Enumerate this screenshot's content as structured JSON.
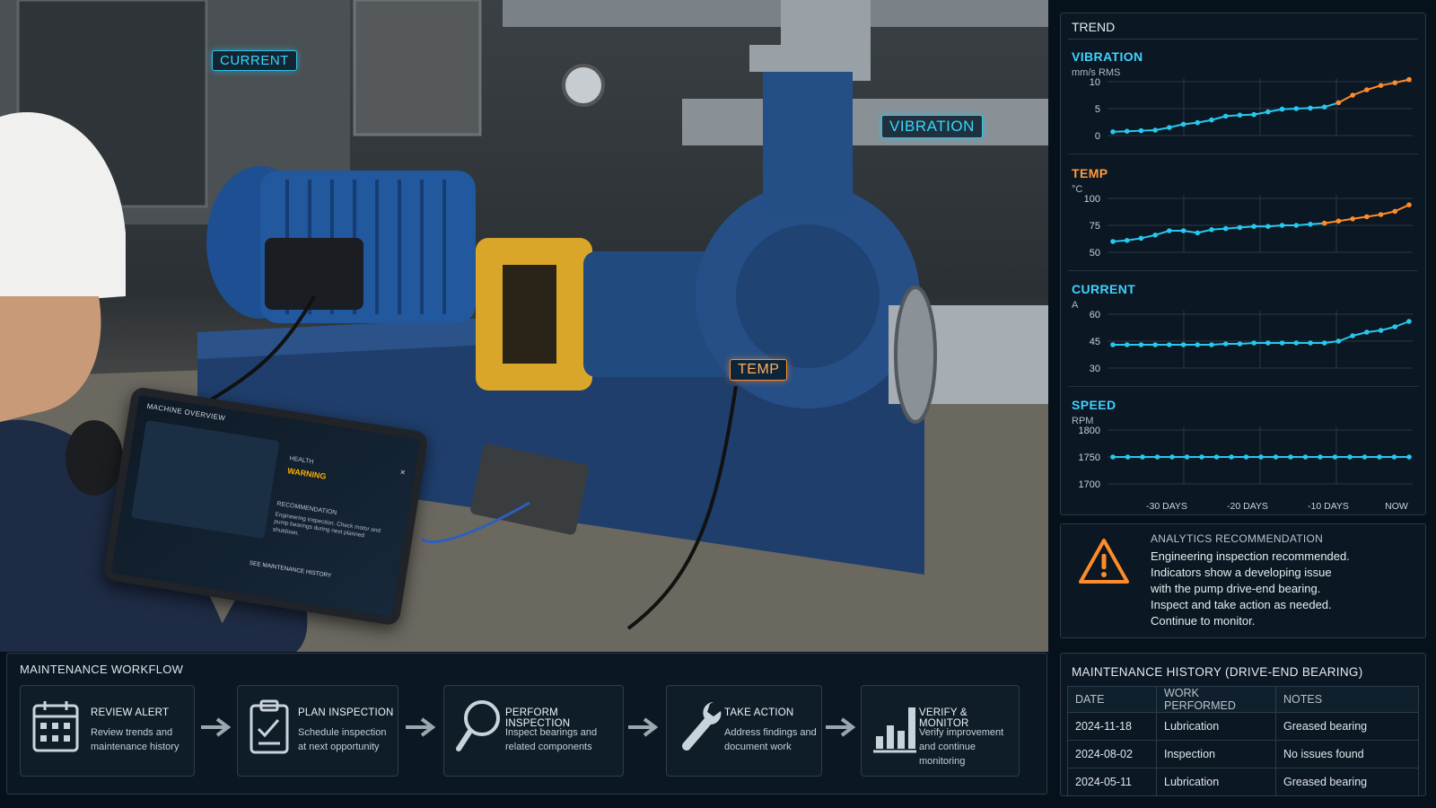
{
  "scene": {
    "tags": {
      "current": "CURRENT",
      "vibration": "VIBRATION",
      "temp": "TEMP"
    },
    "tablet": {
      "title": "MACHINE OVERVIEW",
      "close": "×",
      "health_label": "HEALTH",
      "health_value": "WARNING",
      "recommendation_label": "RECOMMENDATION",
      "recommendation_text": "Engineering inspection. Check motor and pump bearings during next planned shutdown.",
      "link": "SEE MAINTENANCE HISTORY"
    }
  },
  "trend": {
    "title": "TREND",
    "x_labels": [
      "-30 DAYS",
      "-20 DAYS",
      "-10 DAYS",
      "NOW"
    ],
    "charts": [
      {
        "name": "VIBRATION",
        "unit": "mm/s RMS",
        "name_color": "#3fd2ff",
        "ticks": [
          0,
          5,
          10
        ],
        "values": [
          0.7,
          0.8,
          0.9,
          1.0,
          1.5,
          2.1,
          2.4,
          2.9,
          3.6,
          3.8,
          3.9,
          4.4,
          4.9,
          5.0,
          5.1,
          5.3,
          6.1,
          7.5,
          8.5,
          9.3,
          9.8,
          10.4
        ],
        "warn_from": 16
      },
      {
        "name": "TEMP",
        "unit": "°C",
        "name_color": "#ff9b3d",
        "ticks": [
          50,
          75,
          100
        ],
        "values": [
          60,
          61,
          63,
          66,
          70,
          70,
          68,
          71,
          72,
          73,
          74,
          74,
          75,
          75,
          76,
          77,
          79,
          81,
          83,
          85,
          88,
          94
        ],
        "warn_from": 15
      },
      {
        "name": "CURRENT",
        "unit": "A",
        "name_color": "#3fd2ff",
        "ticks": [
          30,
          45,
          60
        ],
        "values": [
          43,
          43,
          43,
          43,
          43,
          43,
          43,
          43,
          43.5,
          43.5,
          44,
          44,
          44,
          44,
          44,
          44,
          45,
          48,
          50,
          51,
          53,
          56
        ],
        "warn_from": 99
      },
      {
        "name": "SPEED",
        "unit": "RPM",
        "name_color": "#3fd2ff",
        "ticks": [
          1700,
          1750,
          1800
        ],
        "values": [
          1750,
          1750,
          1750,
          1750,
          1750,
          1750,
          1750,
          1750,
          1750,
          1750,
          1750,
          1750,
          1750,
          1750,
          1750,
          1750,
          1750,
          1750,
          1750,
          1750,
          1750
        ],
        "warn_from": 99
      }
    ],
    "colors": {
      "normal": "#27c8ef",
      "warning": "#ff8c2a",
      "grid": "#2b3a47"
    }
  },
  "recommendation": {
    "title": "ANALYTICS RECOMMENDATION",
    "lines": [
      "Engineering inspection recommended.",
      "Indicators show a developing issue",
      "with the pump drive-end bearing.",
      "Inspect and take action as needed.",
      "Continue to monitor."
    ],
    "icon": "warning-triangle-icon",
    "icon_color": "#ff8c2a"
  },
  "history": {
    "title": "MAINTENANCE HISTORY (DRIVE-END BEARING)",
    "columns": [
      "DATE",
      "WORK PERFORMED",
      "NOTES"
    ],
    "rows": [
      [
        "2024-11-18",
        "Lubrication",
        "Greased bearing"
      ],
      [
        "2024-08-02",
        "Inspection",
        "No issues found"
      ],
      [
        "2024-05-11",
        "Lubrication",
        "Greased bearing"
      ]
    ]
  },
  "workflow": {
    "title": "MAINTENANCE WORKFLOW",
    "steps": [
      {
        "title": "REVIEW ALERT",
        "desc": [
          "Review trends and",
          "maintenance history"
        ],
        "icon": "calendar-icon"
      },
      {
        "title": "PLAN INSPECTION",
        "desc": [
          "Schedule inspection",
          "at next opportunity"
        ],
        "icon": "clipboard-check-icon"
      },
      {
        "title": "PERFORM INSPECTION",
        "desc": [
          "Inspect bearings and",
          "related components"
        ],
        "icon": "magnifier-icon"
      },
      {
        "title": "TAKE ACTION",
        "desc": [
          "Address findings and",
          "document work"
        ],
        "icon": "wrench-icon"
      },
      {
        "title": "VERIFY & MONITOR",
        "desc": [
          "Verify improvement",
          "and continue",
          "monitoring"
        ],
        "icon": "bar-chart-icon"
      }
    ]
  }
}
